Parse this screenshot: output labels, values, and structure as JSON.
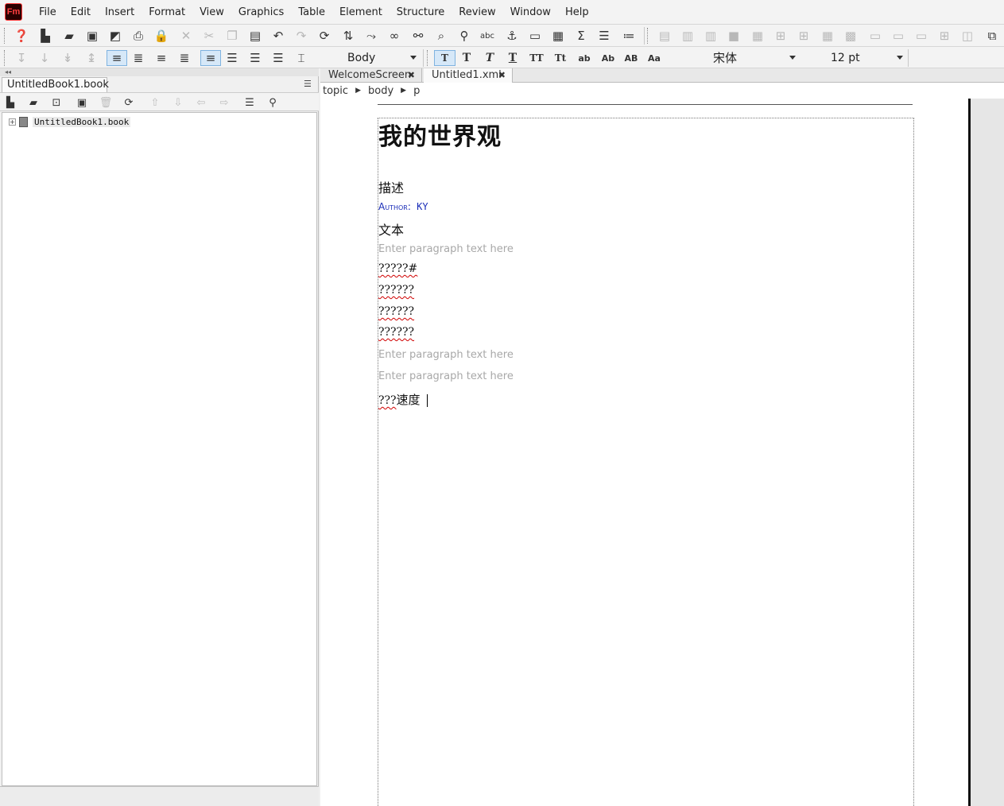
{
  "app": {
    "logo_text": "Fm"
  },
  "menu": [
    "File",
    "Edit",
    "Insert",
    "Format",
    "View",
    "Graphics",
    "Table",
    "Element",
    "Structure",
    "Review",
    "Window",
    "Help"
  ],
  "toolbar2": {
    "style_dropdown": "Body",
    "font_dropdown": "宋体",
    "size_dropdown": "12 pt",
    "char_buttons": [
      "T",
      "T",
      "T",
      "T",
      "TT",
      "Tt",
      "ab",
      "Ab",
      "AB",
      "Aa"
    ]
  },
  "left_pane": {
    "tab_label": "UntitledBook1.book",
    "tree_root": "UntitledBook1.book"
  },
  "doc_tabs": [
    {
      "label": "WelcomeScreen",
      "close": "✖"
    },
    {
      "label": "Untitled1.xml",
      "close": "✖"
    }
  ],
  "breadcrumb": [
    "topic",
    "body",
    "p"
  ],
  "document": {
    "title": "我的世界观",
    "section_desc": "描述",
    "author_prefix": "Author:",
    "author_name": "KY",
    "section_text": "文本",
    "placeholder": "Enter paragraph text here",
    "line1": "?????#",
    "line2": "??????",
    "line3": "??????",
    "line4": "??????",
    "last_prefix": "???",
    "last_text": "速度"
  }
}
